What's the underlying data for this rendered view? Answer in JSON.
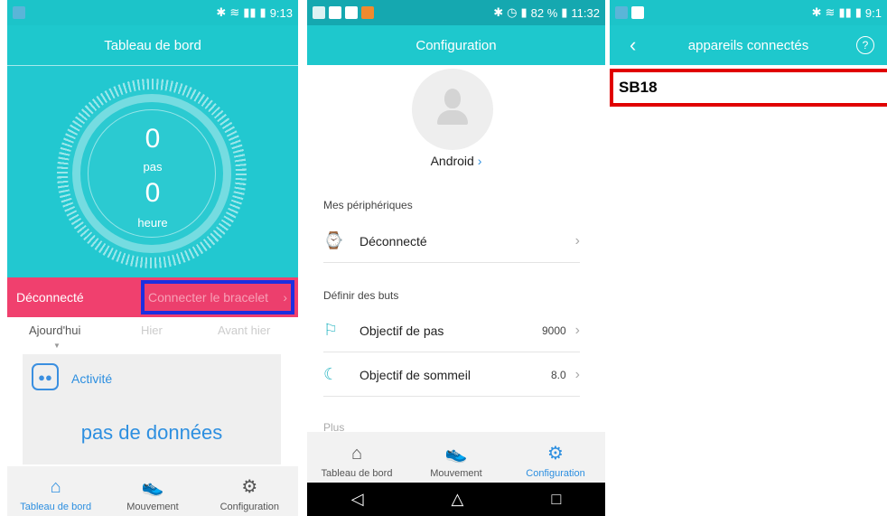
{
  "dashboard": {
    "status_time": "9:13",
    "title": "Tableau de bord",
    "steps_value": "0",
    "steps_label": "pas",
    "hours_value": "0",
    "hours_label": "heure",
    "disconnected": "Déconnecté",
    "connect_button": "Connecter le bracelet",
    "days": [
      "Ajourd'hui",
      "Hier",
      "Avant hier"
    ],
    "activity_title": "Activité",
    "no_data": "pas de données",
    "nav": [
      "Tableau de bord",
      "Mouvement",
      "Configuration"
    ]
  },
  "config": {
    "status_time": "11:32",
    "battery": "82 %",
    "title": "Configuration",
    "user_name": "Android",
    "devices_section": "Mes périphériques",
    "device_status": "Déconnecté",
    "goals_section": "Définir des buts",
    "steps_goal_label": "Objectif de pas",
    "steps_goal_value": "9000",
    "sleep_goal_label": "Objectif de sommeil",
    "sleep_goal_value": "8.0",
    "more_section": "Plus",
    "nav": [
      "Tableau de bord",
      "Mouvement",
      "Configuration"
    ]
  },
  "connected": {
    "status_time": "9:1",
    "title": "appareils connectés",
    "device": "SB18"
  },
  "colors": {
    "teal": "#1ec8cd",
    "pink": "#f0406e",
    "blue_outline": "#1c2fe0",
    "red_outline": "#e00000",
    "accent": "#2d8fe0"
  }
}
